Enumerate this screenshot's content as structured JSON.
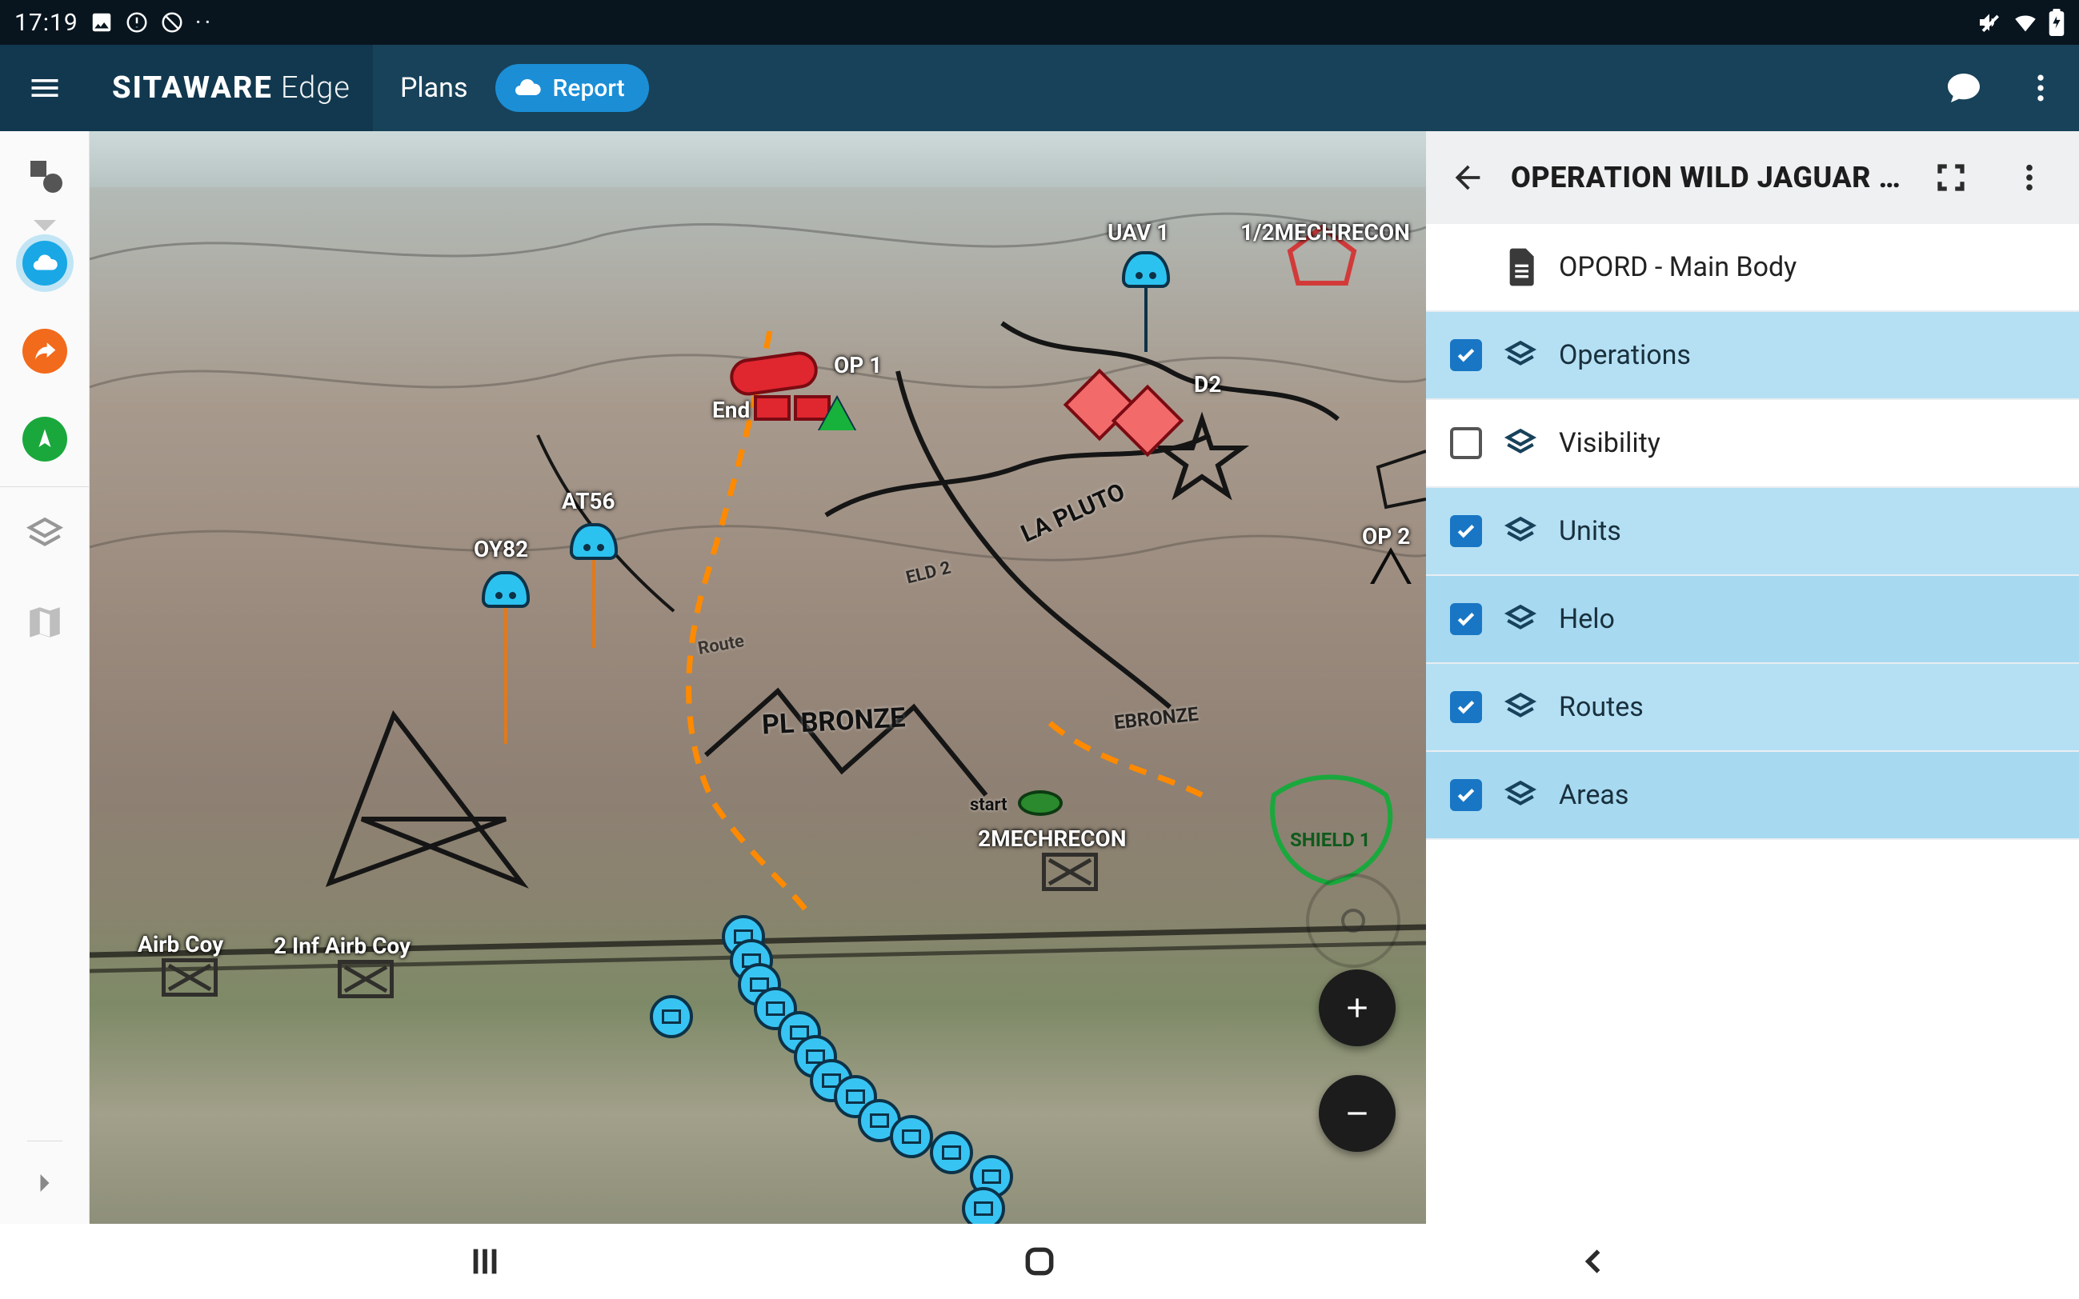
{
  "status": {
    "time": "17:19"
  },
  "header": {
    "brand_strong": "SITAWARE",
    "brand_light": "Edge",
    "plans": "Plans",
    "report": "Report"
  },
  "panel": {
    "title": "OPERATION WILD JAGUAR …",
    "doc": "OPORD - Main Body",
    "layers": [
      {
        "label": "Operations",
        "checked": true,
        "selected": true
      },
      {
        "label": "Visibility",
        "checked": false,
        "selected": false
      },
      {
        "label": "Units",
        "checked": true,
        "selected": true
      },
      {
        "label": "Helo",
        "checked": true,
        "selected": true
      },
      {
        "label": "Routes",
        "checked": true,
        "selected": true
      },
      {
        "label": "Areas",
        "checked": true,
        "selected": true
      }
    ]
  },
  "map": {
    "labels": {
      "uav1": "UAV 1",
      "mech12": "1/2MECHRECON",
      "op1": "OP 1",
      "end": "End",
      "d2": "D2",
      "at56": "AT56",
      "oy82": "OY82",
      "op2": "OP 2",
      "lapluto": "LA PLUTO",
      "plbronze": "PL BRONZE",
      "ebronze": "EBRONZE",
      "eld2": "ELD 2",
      "start": "start",
      "mechrecon2": "2MECHRECON",
      "shield1": "SHIELD 1",
      "airbcoy": "Airb Coy",
      "infairb": "2 Inf Airb Coy",
      "route": "Route"
    }
  },
  "colors": {
    "header": "#17425a",
    "header_dark": "#11384f",
    "accent": "#1b8ed6",
    "friendly": "#2cc2f0",
    "hostile": "#e0262f",
    "panel_sel": "#b5e0f4"
  }
}
